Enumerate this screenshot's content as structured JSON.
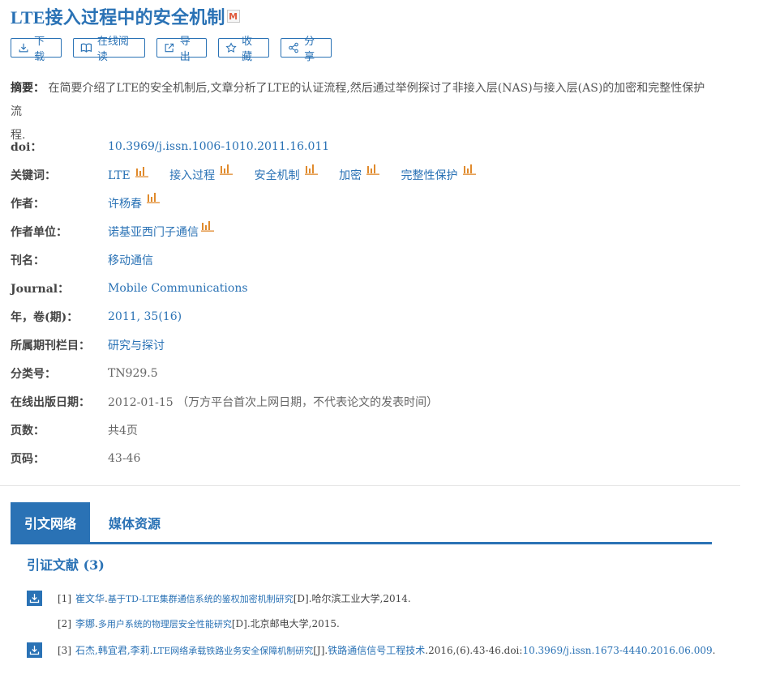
{
  "title": "LTE接入过程中的安全机制",
  "title_badge": "M",
  "toolbar": {
    "download": "下载",
    "read_online": "在线阅读",
    "export": "导出",
    "collect": "收藏",
    "share": "分享"
  },
  "abstract": {
    "label": "摘要：",
    "text": "在简要介绍了LTE的安全机制后,文章分析了LTE的认证流程,然后通过举例探讨了非接入层(NAS)与接入层(AS)的加密和完整性保护流",
    "text_cont": "程."
  },
  "meta": {
    "doi_label": "doi：",
    "doi": "10.3969/j.issn.1006-1010.2011.16.011",
    "keywords_label": "关键词：",
    "keywords": [
      "LTE",
      "接入过程",
      "安全机制",
      "加密",
      "完整性保护"
    ],
    "author_label": "作者：",
    "author": "许杨春",
    "affiliation_label": "作者单位：",
    "affiliation": "诺基亚西门子通信",
    "journal_cn_label": "刊名：",
    "journal_cn": "移动通信",
    "journal_en_label": "Journal：",
    "journal_en": "Mobile Communications",
    "year_label": "年，卷(期)：",
    "year": "2011, 35(16)",
    "column_label": "所属期刊栏目：",
    "column": "研究与探讨",
    "class_label": "分类号：",
    "class": "TN929.5",
    "online_label": "在线出版日期：",
    "online": "2012-01-15 （万方平台首次上网日期，不代表论文的发表时间）",
    "pages_count_label": "页数：",
    "pages_count": "共4页",
    "pages_label": "页码：",
    "pages": "43-46"
  },
  "tabs": [
    "引文网络",
    "媒体资源"
  ],
  "references": {
    "title": "引证文献 (3)",
    "items": [
      {
        "num": "[1]",
        "authors": "崔文华",
        "sep1": ".",
        "title": "基于TD-LTE集群通信系统的鉴权加密机制研究",
        "suffix": "[D].哈尔滨工业大学,2014."
      },
      {
        "num": "[2]",
        "authors": "李娜",
        "sep1": ".",
        "title": "多用户系统的物理层安全性能研究",
        "suffix": "[D].北京邮电大学,2015."
      },
      {
        "num": "[3]",
        "authors": "石杰,韩宜君,李莉",
        "sep1": ".",
        "title": "LTE网络承载铁路业务安全保障机制研究",
        "mid": "[J].",
        "journal": "铁路通信信号工程技术",
        "detail": ".2016,(6).43-46.doi:",
        "doi": "10.3969/j.issn.1673-4440.2016.06.009",
        "end": "."
      }
    ]
  },
  "colors": {
    "accent": "#2a72b5",
    "bar_icon": "#e08a2c"
  }
}
